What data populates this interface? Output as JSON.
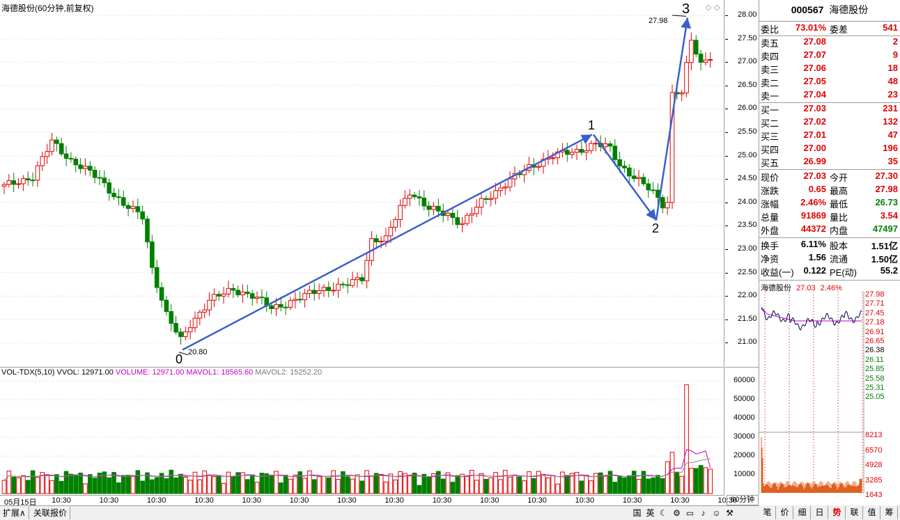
{
  "main": {
    "title": "海德股份(60分钟,前复权)",
    "price_labels": [
      "28.00",
      "27.50",
      "27.00",
      "26.50",
      "26.00",
      "25.50",
      "25.00",
      "24.50",
      "24.00",
      "23.50",
      "23.00",
      "22.50",
      "22.00",
      "21.50",
      "21.00"
    ],
    "annotations": {
      "wave0": "0",
      "wave1": "1",
      "wave2": "2",
      "wave3": "3",
      "high_price": "27.98",
      "low_price": "20.80"
    },
    "colors": {
      "up": "#e00000",
      "down": "#008000",
      "trend": "#3a5fcd",
      "grid": "#dcdcdc"
    }
  },
  "volume": {
    "indicator": "VOL-TDX(5,10)",
    "vvol": "VVOL: 12971.00",
    "volume": "VOLUME: 12971.00",
    "mavol1": "MAVOL1: 18565.60",
    "mavol2": "MAVOL2: 15252.20",
    "axis_labels": [
      "60000",
      "50000",
      "40000",
      "30000",
      "20000",
      "10000"
    ]
  },
  "time_axis": {
    "ticks": [
      "05月15日",
      "10:30",
      "10:30",
      "10:30",
      "10:30",
      "10:30",
      "10:30",
      "10:30",
      "10:30",
      "10:30",
      "10:30",
      "10:30",
      "10:30",
      "10:30",
      "10:30",
      "10:30"
    ],
    "period": "60分钟"
  },
  "bottom": {
    "tabs": [
      "扩展∧",
      "关联报价"
    ],
    "tools": [
      "国",
      "英",
      "☾",
      "⚙",
      "▭",
      "♪",
      "☺",
      "⚒"
    ]
  },
  "quote": {
    "code": "000567",
    "name": "海德股份",
    "weibi_label": "委比",
    "weibi": "73.01%",
    "weicha_label": "委差",
    "weicha": "541",
    "sell": [
      {
        "label": "卖五",
        "price": "27.08",
        "vol": "2"
      },
      {
        "label": "卖四",
        "price": "27.07",
        "vol": "9"
      },
      {
        "label": "卖三",
        "price": "27.06",
        "vol": "18"
      },
      {
        "label": "卖二",
        "price": "27.05",
        "vol": "48"
      },
      {
        "label": "卖一",
        "price": "27.04",
        "vol": "23"
      }
    ],
    "buy": [
      {
        "label": "买一",
        "price": "27.03",
        "vol": "231"
      },
      {
        "label": "买二",
        "price": "27.02",
        "vol": "132"
      },
      {
        "label": "买三",
        "price": "27.01",
        "vol": "47"
      },
      {
        "label": "买四",
        "price": "27.00",
        "vol": "196"
      },
      {
        "label": "买五",
        "price": "26.99",
        "vol": "35"
      }
    ],
    "stats": [
      {
        "l1": "现价",
        "v1": "27.03",
        "l2": "今开",
        "v2": "27.30"
      },
      {
        "l1": "涨跌",
        "v1": "0.65",
        "l2": "最高",
        "v2": "27.98"
      },
      {
        "l1": "涨幅",
        "v1": "2.46%",
        "l2": "最低",
        "v2": "26.73"
      },
      {
        "l1": "总量",
        "v1": "91869",
        "l2": "量比",
        "v2": "3.54"
      },
      {
        "l1": "外盘",
        "v1": "44372",
        "l2": "内盘",
        "v2": "47497"
      }
    ],
    "finance": [
      {
        "l1": "换手",
        "v1": "6.11%",
        "l2": "股本",
        "v2": "1.51亿"
      },
      {
        "l1": "净资",
        "v1": "1.56",
        "l2": "流通",
        "v2": "1.50亿"
      },
      {
        "l1": "收益(一)",
        "v1": "0.122",
        "l2": "PE(动)",
        "v2": "55.2"
      }
    ]
  },
  "mini": {
    "name": "海德股份",
    "price": "27.03",
    "pct": "2.46%",
    "price_labels_up": [
      "27.98",
      "27.71",
      "27.45",
      "27.18",
      "26.91",
      "26.65"
    ],
    "price_mid": "26.38",
    "price_labels_down": [
      "26.11",
      "25.85",
      "25.58",
      "25.31",
      "25.05"
    ],
    "vol_labels": [
      "8213",
      "6570",
      "4928",
      "3285",
      "1643"
    ]
  },
  "right_tabs": [
    "笔",
    "价",
    "细",
    "日",
    "势",
    "联",
    "值",
    "筹"
  ],
  "chart_data": {
    "type": "candlestick",
    "title": "海德股份(60分钟,前复权)",
    "ylim": [
      20.7,
      28.1
    ],
    "wave_points": [
      {
        "label": "0",
        "price": 20.8
      },
      {
        "label": "1",
        "price": 25.45
      },
      {
        "label": "2",
        "price": 23.6
      },
      {
        "label": "3",
        "price": 27.98
      }
    ]
  }
}
